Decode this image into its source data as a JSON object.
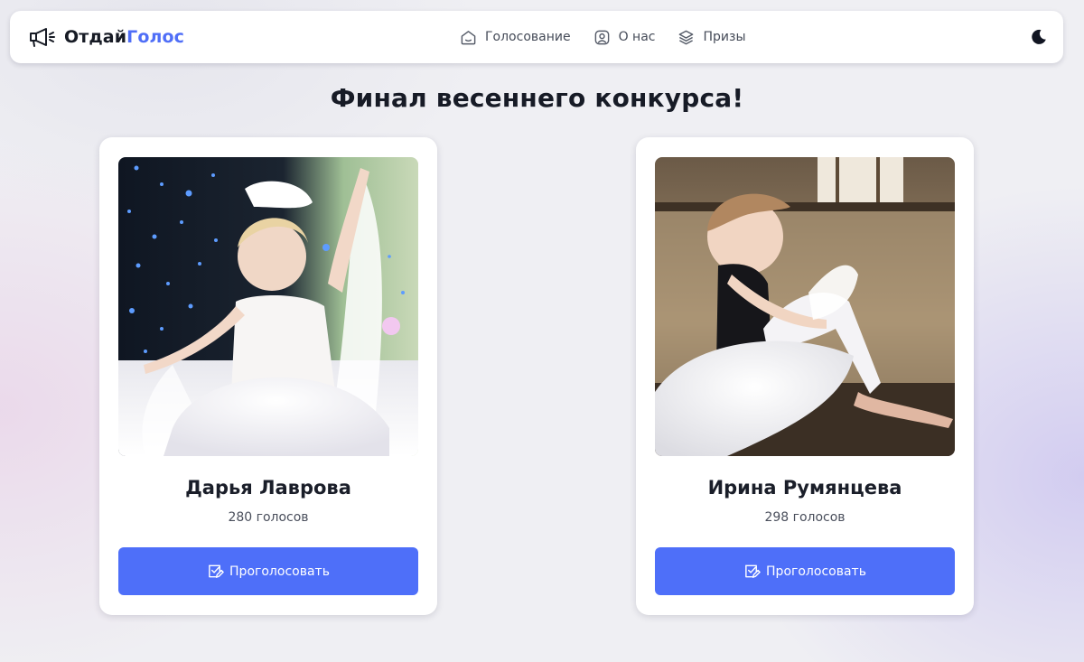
{
  "header": {
    "logo_part1": "Отдай",
    "logo_part2": "Голос",
    "logo_icon": "megaphone-icon",
    "nav": [
      {
        "label": "Голосование",
        "icon": "home-icon"
      },
      {
        "label": "О нас",
        "icon": "user-circle-icon"
      },
      {
        "label": "Призы",
        "icon": "layers-icon"
      }
    ],
    "theme_icon": "moon-icon"
  },
  "page": {
    "title": "Финал весеннего конкурса!"
  },
  "contestants": [
    {
      "name": "Дарья Лаврова",
      "votes": "280 голосов",
      "button_label": "Проголосовать",
      "button_icon": "vote-check-icon",
      "photo": "ballerina-photo"
    },
    {
      "name": "Ирина Румянцева",
      "votes": "298 голосов",
      "button_label": "Проголосовать",
      "button_icon": "vote-check-icon",
      "photo": "ballerina-photo"
    }
  ],
  "colors": {
    "accent": "#4e6ff9",
    "logo_accent": "#4f6ef7",
    "text_dark": "#171b26"
  }
}
